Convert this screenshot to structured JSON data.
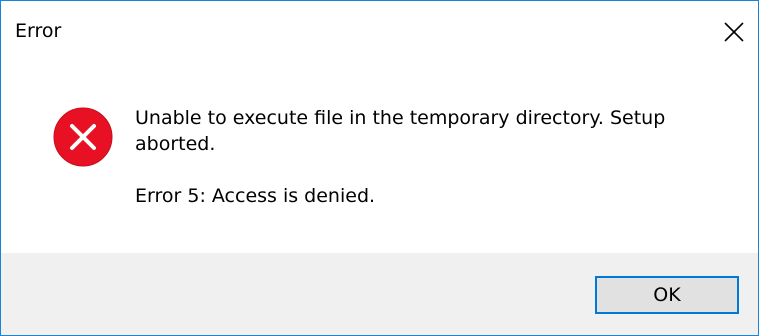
{
  "window": {
    "title": "Error"
  },
  "message": {
    "main": "Unable to execute file in the temporary directory. Setup aborted.",
    "detail": "Error 5: Access is denied."
  },
  "buttons": {
    "ok_label": "OK"
  },
  "icons": {
    "status": "error-icon",
    "close": "close-icon"
  },
  "colors": {
    "error_red": "#e81123",
    "accent_blue": "#0078d7",
    "footer_bg": "#f0f0f0"
  }
}
